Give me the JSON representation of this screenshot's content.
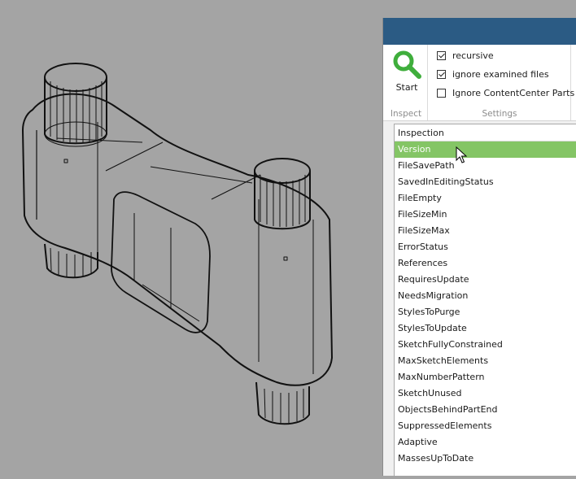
{
  "ribbon": {
    "start_label": "Start",
    "inspect_group_label": "Inspect",
    "settings_group_label": "Settings",
    "start_icon": "magnifier-icon",
    "accent_color": "#3fae3c",
    "options": [
      {
        "label": "recursive",
        "checked": true
      },
      {
        "label": "ignore examined files",
        "checked": true
      },
      {
        "label": "Ignore ContentCenter Parts",
        "checked": false
      }
    ]
  },
  "inspection": {
    "header": "Inspection",
    "selected_color": "#84c565",
    "items": [
      {
        "label": "Version",
        "selected": true
      },
      {
        "label": "FileSavePath"
      },
      {
        "label": "SavedInEditingStatus"
      },
      {
        "label": "FileEmpty"
      },
      {
        "label": "FileSizeMin"
      },
      {
        "label": "FileSizeMax"
      },
      {
        "label": "ErrorStatus"
      },
      {
        "label": "References"
      },
      {
        "label": "RequiresUpdate"
      },
      {
        "label": "NeedsMigration"
      },
      {
        "label": "StylesToPurge"
      },
      {
        "label": "StylesToUpdate"
      },
      {
        "label": "SketchFullyConstrained"
      },
      {
        "label": "MaxSketchElements"
      },
      {
        "label": "MaxNumberPattern"
      },
      {
        "label": "SketchUnused"
      },
      {
        "label": "ObjectsBehindPartEnd"
      },
      {
        "label": "SuppressedElements"
      },
      {
        "label": "Adaptive"
      },
      {
        "label": "MassesUpToDate"
      }
    ]
  }
}
